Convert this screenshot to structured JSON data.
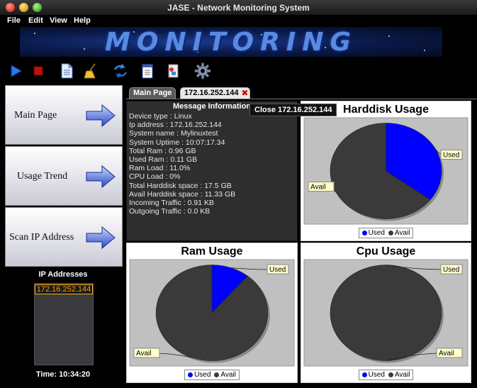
{
  "window": {
    "title": "JASE - Network Monitoring System"
  },
  "menu": {
    "items": [
      "File",
      "Edit",
      "View",
      "Help"
    ]
  },
  "banner": {
    "text": "MONITORING"
  },
  "toolbar": {
    "icons": [
      "play-icon",
      "stop-icon",
      "document-icon",
      "broom-icon",
      "refresh-icon",
      "notepad-icon",
      "script-icon",
      "gear-icon"
    ]
  },
  "sidebar": {
    "buttons": [
      "Main Page",
      "Usage Trend",
      "Scan IP Address"
    ],
    "ip_title": "IP Addresses",
    "ip_list": [
      "172.16.252.144"
    ],
    "time": "Time: 10:34:20"
  },
  "tabs": [
    {
      "label": "Main Page"
    },
    {
      "label": "172.16.252.144"
    }
  ],
  "tooltip": "Close 172.16.252.144",
  "message_panel": {
    "title": "Message Information",
    "lines": [
      "Device type : Linux",
      "Ip address : 172.16.252.144",
      "System name : Mylinuxtest",
      "System Uptime : 10:07:17.34",
      "Total Ram : 0.96 GB",
      "Used Ram : 0.11 GB",
      "Ram Load : 11.0%",
      "CPU Load : 0%",
      "Total Harddisk space : 17.5 GB",
      "Avail Harddisk space : 11.33 GB",
      "Incoming Traffic : 0.91 KB",
      "Outgoing Traffic : 0.0 KB"
    ]
  },
  "colors": {
    "used": "#0000ff",
    "avail": "#3a3a3a",
    "plot_bg": "#c0c0c0"
  },
  "chart_data": [
    {
      "type": "pie",
      "title": "Harddisk Usage",
      "categories": [
        "Used",
        "Avail"
      ],
      "values": [
        35.3,
        64.7
      ]
    },
    {
      "type": "pie",
      "title": "Ram Usage",
      "categories": [
        "Used",
        "Avail"
      ],
      "values": [
        11.0,
        89.0
      ]
    },
    {
      "type": "pie",
      "title": "Cpu Usage",
      "categories": [
        "Used",
        "Avail"
      ],
      "values": [
        0,
        100
      ]
    }
  ]
}
